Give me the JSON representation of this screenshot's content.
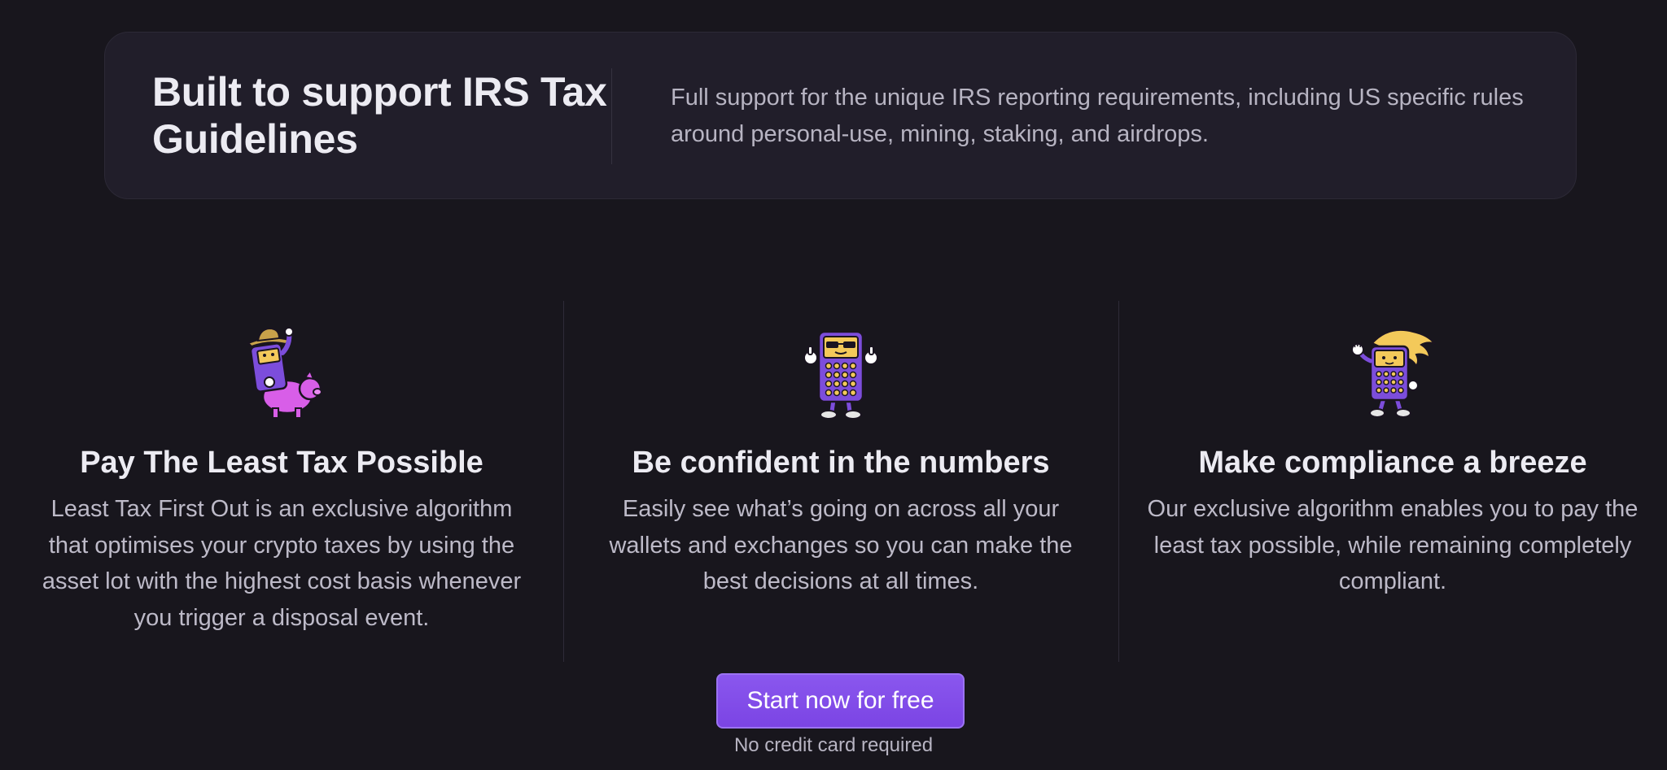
{
  "irs": {
    "title": "Built to support IRS Tax Guidelines",
    "description": "Full support for the unique IRS reporting requirements, including US specific rules around personal-use, mining, staking, and airdrops."
  },
  "features": [
    {
      "icon": "cowboy-calculator-riding-pig-mascot",
      "title": "Pay The Least Tax Possible",
      "text": "Least Tax First Out is an exclusive algorithm that optimises your crypto taxes by using the asset lot with the highest cost basis whenever you trigger a disposal event."
    },
    {
      "icon": "sunglasses-calculator-thumbs-up-mascot",
      "title": "Be confident in the numbers",
      "text": "Easily see what’s going on across all your wallets and exchanges so you can make the best decisions at all times."
    },
    {
      "icon": "windswept-hair-calculator-mascot",
      "title": "Make compliance a breeze",
      "text": "Our exclusive algorithm enables you to pay the least tax possible, while remaining completely compliant."
    }
  ],
  "cta": {
    "label": "Start now for free",
    "note": "No credit card required"
  },
  "colors": {
    "background": "#18161d",
    "card": "#211e2a",
    "accent": "#7b44e4",
    "mascot_purple": "#7c4ddb",
    "mascot_yellow": "#f3c95a",
    "pig_pink": "#d85ee8"
  }
}
